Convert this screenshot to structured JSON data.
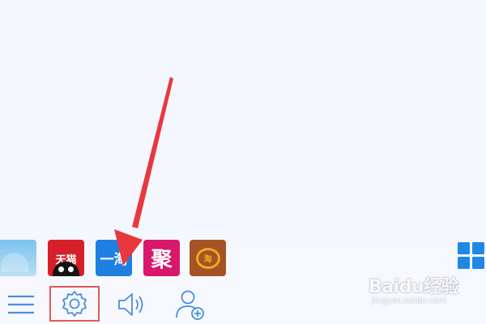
{
  "app_row": {
    "tiles": [
      {
        "name": "partial-app",
        "label": ""
      },
      {
        "name": "tmall",
        "label": "天猫"
      },
      {
        "name": "yitao",
        "label": "一淘"
      },
      {
        "name": "juhuasuan",
        "label": "聚"
      },
      {
        "name": "gold-coin",
        "label": "淘"
      }
    ],
    "grid_icon": "apps-grid-icon"
  },
  "toolbar": {
    "items": [
      {
        "name": "menu-icon"
      },
      {
        "name": "settings-gear-icon"
      },
      {
        "name": "volume-icon"
      },
      {
        "name": "add-friend-icon"
      }
    ],
    "highlight_color": "#e05a5a"
  },
  "annotation": {
    "arrow_color": "#e8383d"
  },
  "watermark": {
    "title": "Baidu经验",
    "url": "jingyan.baidu.com"
  },
  "colors": {
    "tmall": "#d61f29",
    "yitao": "#1f7fe0",
    "ju": "#d8186b",
    "coin_bg": "#a35424",
    "coin": "#f6a623",
    "icon_blue": "#1f88e5",
    "tool_icon": "#4a8fd8"
  }
}
